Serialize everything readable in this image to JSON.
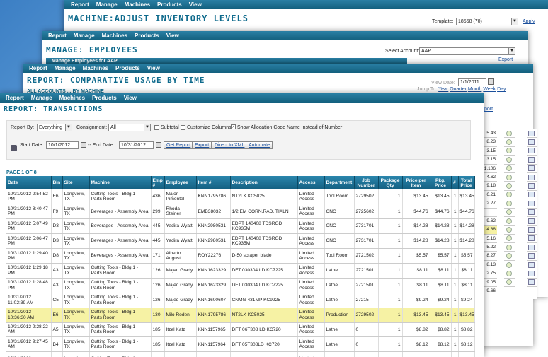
{
  "nav_items": [
    "Report",
    "Manage",
    "Machines",
    "Products",
    "View"
  ],
  "win1": {
    "title": "MACHINE:ADJUST INVENTORY LEVELS",
    "template_label": "Template:",
    "template_value": "18558 (70)",
    "apply_label": "Apply"
  },
  "win2": {
    "title": "MANAGE: EMPLOYEES",
    "subheader": "Manage Employees for AAP",
    "account_label": "Select Account:",
    "account_value": "AAP",
    "export_label": "Export"
  },
  "win3": {
    "title": "REPORT: COMPARATIVE USAGE BY TIME",
    "view_date_label": "View Date:",
    "view_date_value": "1/1/2011",
    "jump_label": "Jump To:",
    "jump_year": "Year",
    "jump_quarter": "Quarter",
    "jump_month": "Month",
    "jump_week": "Week",
    "jump_day": "Day",
    "sub_label": "ALL ACCOUNTS ... BY MACHINE"
  },
  "right_strip": [
    "5.43",
    "8.23",
    "3.15",
    "3.15",
    "1.106",
    "4.62",
    "9.18",
    "6.21",
    "2.27",
    "",
    "9.62",
    "4.88",
    "5.16",
    "5.22",
    "8.27",
    "8.13",
    "2.75",
    "9.05",
    "9.66"
  ],
  "main": {
    "title": "REPORT: TRANSACTIONS",
    "report_by_label": "Report By:",
    "report_by_value": "Everything",
    "consignment_label": "Consignment:",
    "consignment_value": "All",
    "subtotal_label": "Subtotal",
    "customize_label": "Customize Columns",
    "allocation_label": "Show Allocation Code Name Instead of Number",
    "start_date_label": "Start Date:",
    "start_date_value": "10/1/2012",
    "end_date_label": "-- End Date:",
    "end_date_value": "10/31/2012",
    "get_report": "Get Report",
    "export": "Export",
    "direct_xml": "Direct to XML",
    "automate": "Automate",
    "page_label": "PAGE 1 OF 8",
    "report_link": "port"
  },
  "table": {
    "headers": [
      "Date",
      "Bin",
      "Site",
      "Machine",
      "Emp #",
      "Employee",
      "Item #",
      "Description",
      "Access",
      "Department",
      "Job Number",
      "Package Qty",
      "Price per Item",
      "Pkg. Price",
      "#",
      "Total Price"
    ],
    "rows": [
      [
        "10/31/2012 9:54:52 PM",
        "E6",
        "Longview, TX",
        "Cutting Tools - Bldg 1 - Parts Room",
        "436",
        "Major Pimentel",
        "KNN1795786",
        "NT2LK KC5025",
        "Limited Access",
        "Tool Room",
        "2729502",
        "1",
        "$13.45",
        "$13.45",
        "1",
        "$13.45"
      ],
      [
        "10/31/2012 8:40:47 PM",
        "F9",
        "Longview, TX",
        "Beverages - Assembly Area",
        "299",
        "Rhoda Steiner",
        "EMB38032",
        "1/2 EM CORN.RAD. TIALN",
        "Limited Access",
        "CNC",
        "2725602",
        "1",
        "$44.76",
        "$44.76",
        "1",
        "$44.76"
      ],
      [
        "10/31/2012 5:07:49 PM",
        "D3",
        "Longview, TX",
        "Beverages - Assembly Area",
        "445",
        "Yadira Wyatt",
        "KNN2980531",
        "EDPT 140408 TDSRGD KC935M",
        "Limited Access",
        "CNC",
        "2731701",
        "1",
        "$14.28",
        "$14.28",
        "1",
        "$14.28"
      ],
      [
        "10/31/2012 5:06:47 PM",
        "D3",
        "Longview, TX",
        "Beverages - Assembly Area",
        "445",
        "Yadira Wyatt",
        "KNN2980531",
        "EDPT 140408 TDSRGD KC935M",
        "Limited Access",
        "CNC",
        "2731701",
        "1",
        "$14.28",
        "$14.28",
        "1",
        "$14.28"
      ],
      [
        "10/31/2012 1:29:40 PM",
        "D8",
        "Longview, TX",
        "Beverages - Assembly Area",
        "171",
        "Alberto August",
        "ROY22276",
        "D-50 scraper blade",
        "Limited Access",
        "Tool Room",
        "2721502",
        "1",
        "$5.57",
        "$5.57",
        "1",
        "$5.57"
      ],
      [
        "10/31/2012 1:29:18 PM",
        "A3",
        "Longview, TX",
        "Cutting Tools - Bldg 1 - Parts Room",
        "126",
        "Majed Grady",
        "KNN1623329",
        "DFT 030304 LD KC7225",
        "Limited Access",
        "Lathe",
        "2721501",
        "1",
        "$8.11",
        "$8.11",
        "1",
        "$8.11"
      ],
      [
        "10/31/2012 1:28:48 PM",
        "A3",
        "Longview, TX",
        "Cutting Tools - Bldg 1 - Parts Room",
        "126",
        "Majed Grady",
        "KNN1623329",
        "DFT 030304 LD KC7225",
        "Limited Access",
        "Lathe",
        "2721501",
        "1",
        "$8.11",
        "$8.11",
        "1",
        "$8.11"
      ],
      [
        "10/31/2012 11:02:39 AM",
        "C5",
        "Longview, TX",
        "Cutting Tools - Bldg 1 - Parts Room",
        "126",
        "Majed Grady",
        "KNN1600607",
        "CNMG 431MP KC9225",
        "Limited Access",
        "Lathe",
        "27215",
        "1",
        "$9.24",
        "$9.24",
        "1",
        "$9.24"
      ],
      [
        "10/31/2012 10:36:30 AM",
        "E6",
        "Longview, TX",
        "Cutting Tools - Bldg 1 - Parts Room",
        "130",
        "Milo Roden",
        "KNN1795786",
        "NT2LK KC5025",
        "Limited Access",
        "Production",
        "2729502",
        "1",
        "$13.45",
        "$13.45",
        "1",
        "$13.45"
      ],
      [
        "10/31/2012 9:28:22 AM",
        "A5",
        "Longview, TX",
        "Cutting Tools - Bldg 1 - Parts Room",
        "185",
        "Itzel Katz",
        "KNN1157965",
        "DFT 06T308 LD KC720",
        "Limited Access",
        "Lathe",
        "0",
        "1",
        "$8.82",
        "$8.82",
        "1",
        "$8.82"
      ],
      [
        "10/31/2012 9:27:45 AM",
        "B4",
        "Longview, TX",
        "Cutting Tools - Bldg 1 - Parts Room",
        "185",
        "Itzel Katz",
        "KNN1157964",
        "DFT 05T308LD KC720",
        "Limited Access",
        "Lathe",
        "0",
        "1",
        "$8.12",
        "$8.12",
        "1",
        "$8.12"
      ],
      [
        "10/31/2012",
        "",
        "Longview,",
        "Cutting Tools - Bldg 1 -",
        "",
        "",
        "",
        "",
        "Limited",
        "",
        "",
        "",
        "",
        "",
        "",
        ""
      ]
    ],
    "highlight_row": 8
  }
}
